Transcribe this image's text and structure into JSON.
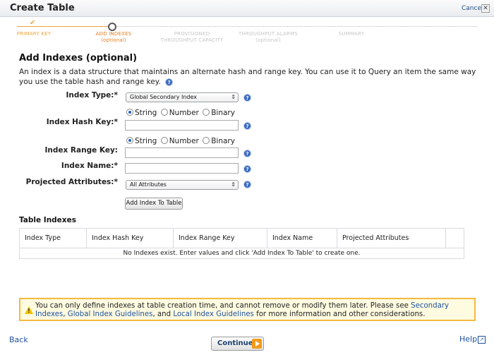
{
  "dialog": {
    "title": "Create Table",
    "cancel_label": "Cancel",
    "close_glyph": "✕"
  },
  "wizard": {
    "steps": [
      {
        "label": "PRIMARY KEY",
        "sub": "",
        "state": "done"
      },
      {
        "label": "ADD INDEXES",
        "sub": "(optional)",
        "state": "active"
      },
      {
        "label": "PROVISIONED",
        "sub": "THROUGHPUT CAPACITY",
        "state": "todo"
      },
      {
        "label": "THROUGHPUT ALARMS",
        "sub": "(optional)",
        "state": "todo"
      },
      {
        "label": "SUMMARY",
        "sub": "",
        "state": "todo"
      }
    ],
    "done_mark": "✔",
    "accent_color": "#f0a23a"
  },
  "section": {
    "title": "Add Indexes (optional)",
    "description": "An index is a data structure that maintains an alternate hash and range key. You can use it to Query an item the same way you use the table hash and range key."
  },
  "form": {
    "index_type": {
      "label": "Index Type:*",
      "value": "Global Secondary Index"
    },
    "hash_key": {
      "label": "Index Hash Key:*",
      "value": "",
      "types": [
        "String",
        "Number",
        "Binary"
      ],
      "selected": "String"
    },
    "range_key": {
      "label": "Index Range Key:",
      "value": "",
      "types": [
        "String",
        "Number",
        "Binary"
      ],
      "selected": "String"
    },
    "index_name": {
      "label": "Index Name:*",
      "value": ""
    },
    "projected": {
      "label": "Projected Attributes:*",
      "value": "All Attributes"
    },
    "add_button": "Add Index To Table",
    "help_glyph": "?"
  },
  "table_indexes": {
    "title": "Table Indexes",
    "columns": [
      "Index Type",
      "Index Hash Key",
      "Index Range Key",
      "Index Name",
      "Projected Attributes"
    ],
    "empty_message": "No Indexes exist. Enter values and click 'Add Index To Table' to create one."
  },
  "warning": {
    "text_1": "You can only define indexes at table creation time, and cannot remove or modify them later. Please see ",
    "link_1a": "Secondary",
    "link_1b": "Indexes",
    "sep_1": ", ",
    "link_2": "Global Index Guidelines",
    "sep_2": ", and ",
    "link_3": "Local Index Guidelines",
    "text_2": " for more information and other considerations."
  },
  "footer": {
    "back": "Back",
    "continue": "Continue",
    "help": "Help",
    "help_ext_glyph": "↗"
  }
}
